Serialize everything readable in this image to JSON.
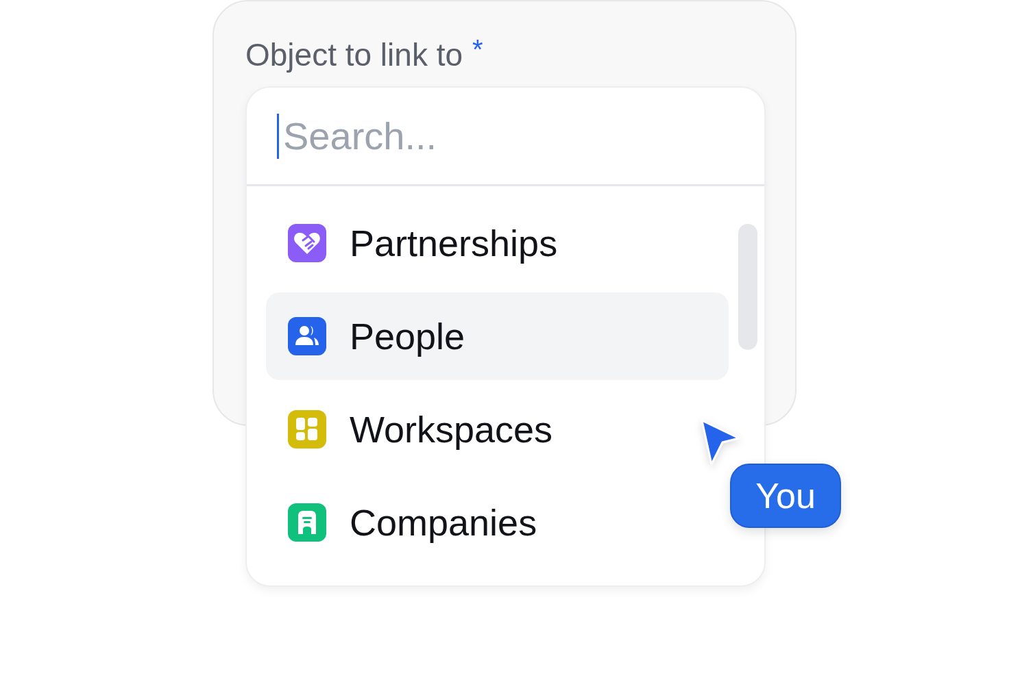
{
  "field": {
    "label": "Object to link to",
    "required": true,
    "required_mark": "*"
  },
  "search": {
    "placeholder": "Search..."
  },
  "options": [
    {
      "label": "Partnerships",
      "kind": "handshake",
      "color": "#8b5cf6",
      "selected": false
    },
    {
      "label": "People",
      "kind": "people",
      "color": "#2563eb",
      "selected": true
    },
    {
      "label": "Workspaces",
      "kind": "grid",
      "color": "#d4bd0a",
      "selected": false
    },
    {
      "label": "Companies",
      "kind": "building",
      "color": "#10c17d",
      "selected": false
    }
  ],
  "cursor": {
    "name": "You"
  }
}
